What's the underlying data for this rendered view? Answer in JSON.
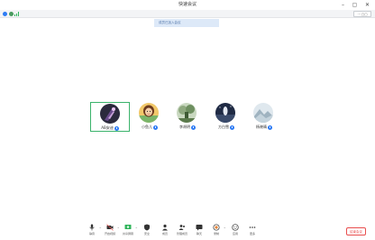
{
  "window": {
    "title": "快速会议"
  },
  "toolbar": {
    "layout_label": "··· ▢▢"
  },
  "banner": {
    "text": "成员已加入会议"
  },
  "participants": [
    {
      "name": "AB安迪",
      "avatar": "dark-avatar",
      "active": true
    },
    {
      "name": "小鱼儿",
      "avatar": "girl-avatar",
      "active": false
    },
    {
      "name": "李胡明",
      "avatar": "landscape-avatar",
      "active": false
    },
    {
      "name": "方白雪",
      "avatar": "night-avatar",
      "active": false
    },
    {
      "name": "杨晓晴",
      "avatar": "mountain-avatar",
      "active": false
    }
  ],
  "controls": [
    {
      "label": "静音",
      "icon": "mic-icon"
    },
    {
      "label": "开启视频",
      "icon": "camera-icon"
    },
    {
      "label": "共享屏幕",
      "icon": "screen-share-icon"
    },
    {
      "label": "安全",
      "icon": "shield-icon"
    },
    {
      "label": "成员",
      "icon": "members-icon"
    },
    {
      "label": "管理成员",
      "icon": "manage-members-icon"
    },
    {
      "label": "聊天",
      "icon": "chat-icon"
    },
    {
      "label": "录制",
      "icon": "record-icon"
    },
    {
      "label": "应用",
      "icon": "apps-icon"
    },
    {
      "label": "更多",
      "icon": "more-icon"
    }
  ],
  "leave_label": "结束会议",
  "colors": {
    "active_border": "#3bb36b",
    "mic_badge": "#2d7bf4",
    "leave": "#e84d4d",
    "banner_bg": "#dde9f8"
  }
}
